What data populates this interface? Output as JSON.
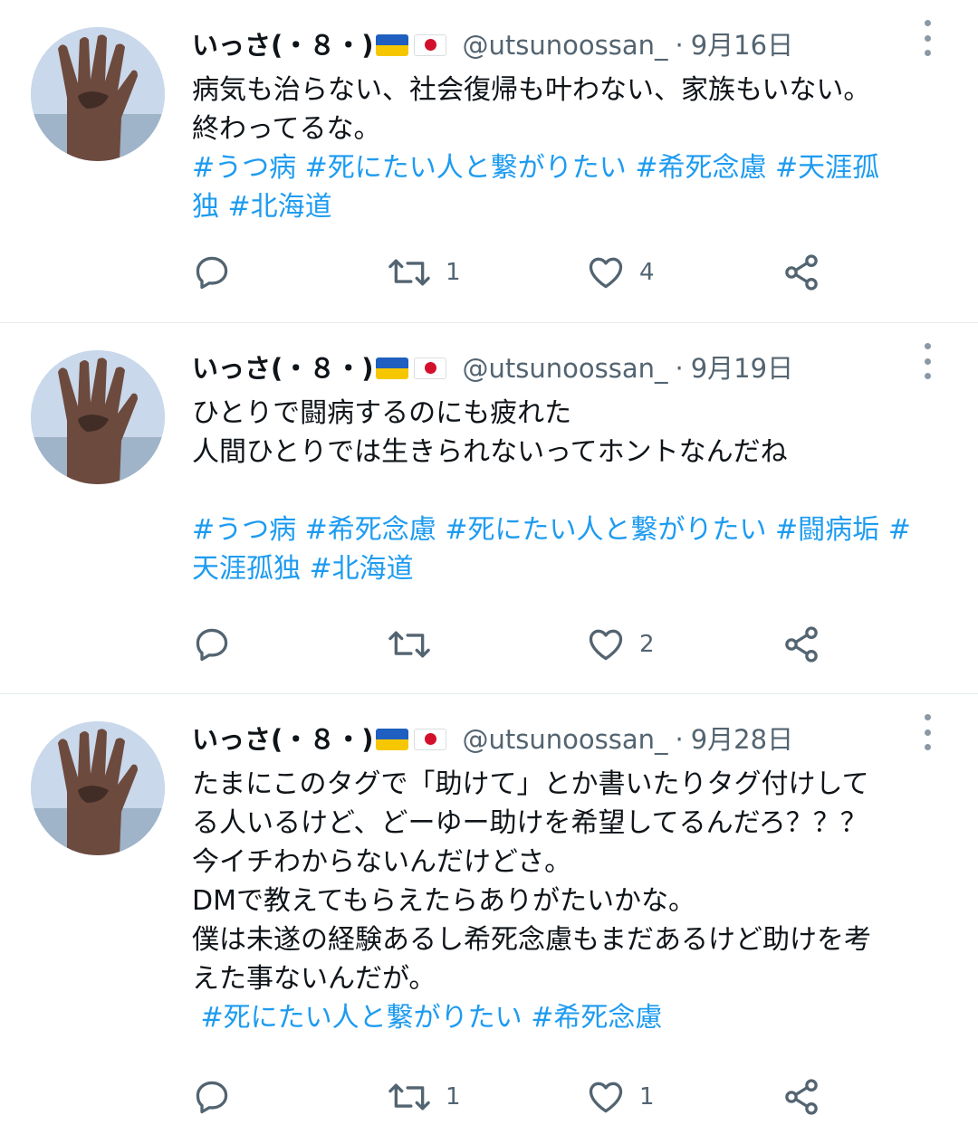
{
  "tweets": [
    {
      "name": "いっさ(・８・)",
      "handle": "@utsunoossan_",
      "separator": "·",
      "date": "9月16日",
      "text_lines": [
        "病気も治らない、社会復帰も叶わない、家族もいない。",
        "終わってるな。"
      ],
      "hashtag_lines": [
        "#うつ病 #死にたい人と繋がりたい #希死念慮 #天涯孤",
        "独 #北海道"
      ],
      "retweets": "1",
      "likes": "4"
    },
    {
      "name": "いっさ(・８・)",
      "handle": "@utsunoossan_",
      "separator": "·",
      "date": "9月19日",
      "text_lines": [
        "ひとりで闘病するのにも疲れた",
        "人間ひとりでは生きられないってホントなんだね"
      ],
      "hashtag_lines": [
        "#うつ病 #希死念慮 #死にたい人と繋がりたい #闘病垢 #",
        "天涯孤独 #北海道"
      ],
      "retweets": "",
      "likes": "2"
    },
    {
      "name": "いっさ(・８・)",
      "handle": "@utsunoossan_",
      "separator": "·",
      "date": "9月28日",
      "text_lines": [
        "たまにこのタグで「助けて」とか書いたりタグ付けして",
        "る人いるけど、どーゆー助けを希望してるんだろ？？？",
        "今イチわからないんだけどさ。",
        "DMで教えてもらえたらありがたいかな。",
        "僕は未遂の経験あるし希死念慮もまだあるけど助けを考",
        "えた事ないんだが。"
      ],
      "hashtag_lines": [
        " #死にたい人と繋がりたい #希死念慮"
      ],
      "retweets": "1",
      "likes": "1"
    }
  ],
  "colors": {
    "hashtag": "#1d9bf0",
    "secondary_text": "#536471",
    "divider": "#e6ecf0"
  },
  "icons": [
    "avatar-hand-photo",
    "ukraine-flag",
    "japan-flag",
    "more-dots-icon",
    "reply-icon",
    "retweet-icon",
    "like-heart-icon",
    "share-icon"
  ]
}
